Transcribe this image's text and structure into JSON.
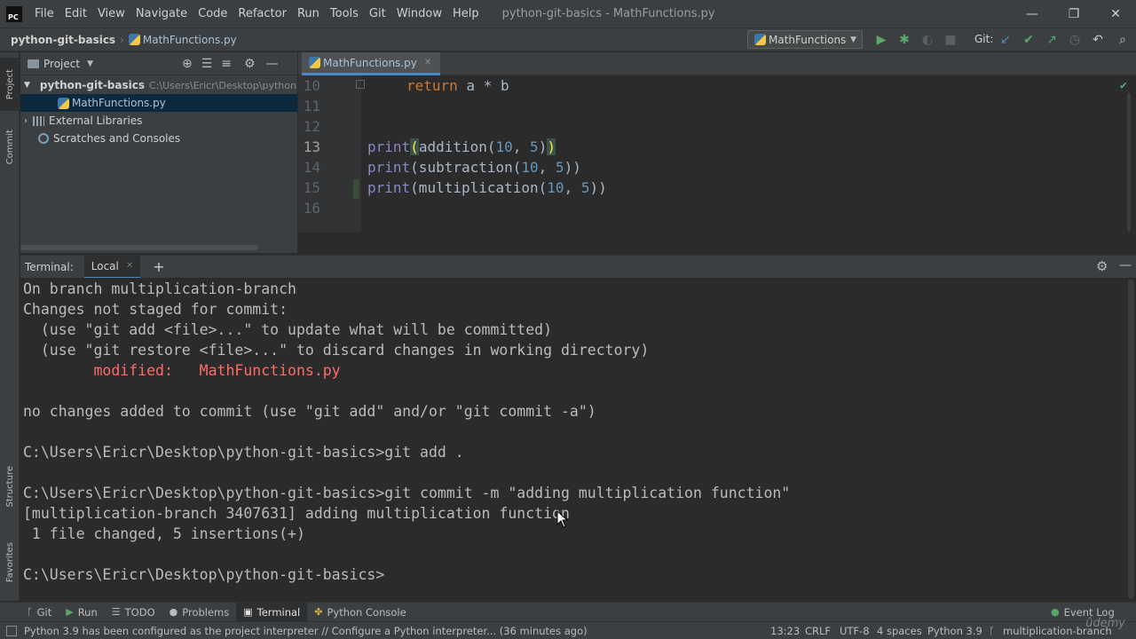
{
  "app": {
    "logo_text": "PC",
    "window_title": "python-git-basics - MathFunctions.py"
  },
  "menu": [
    "File",
    "Edit",
    "View",
    "Navigate",
    "Code",
    "Refactor",
    "Run",
    "Tools",
    "Git",
    "Window",
    "Help"
  ],
  "window_controls": {
    "minimize": "—",
    "restore": "❐",
    "close": "✕"
  },
  "navbar": {
    "project": "python-git-basics",
    "file": "MathFunctions.py",
    "run_config": "MathFunctions",
    "git_label": "Git:"
  },
  "left_strip": {
    "project": "Project",
    "commit": "Commit",
    "structure": "Structure",
    "favorites": "Favorites"
  },
  "project_panel": {
    "title": "Project",
    "tree": [
      {
        "label": "python-git-basics",
        "path": "C:\\Users\\Ericr\\Desktop\\python-g"
      },
      {
        "label": "MathFunctions.py"
      },
      {
        "label": "External Libraries"
      },
      {
        "label": "Scratches and Consoles"
      }
    ]
  },
  "editor": {
    "tab": "MathFunctions.py",
    "lines": [
      {
        "n": "10"
      },
      {
        "n": "11"
      },
      {
        "n": "12"
      },
      {
        "n": "13"
      },
      {
        "n": "14"
      },
      {
        "n": "15"
      },
      {
        "n": "16"
      }
    ],
    "code": {
      "l10_kw": "return",
      "l10_rest": " a * b",
      "l13_fn": "print",
      "l13_open": "(",
      "l13_call": "addition(",
      "l13_a": "10",
      "l13_sep": ", ",
      "l13_b": "5",
      "l13_close1": ")",
      "l13_close2": ")",
      "l14_fn": "print",
      "l14_call": "(subtraction(",
      "l14_a": "10",
      "l14_sep": ", ",
      "l14_b": "5",
      "l14_end": "))",
      "l15_fn": "print",
      "l15_call": "(multiplication(",
      "l15_a": "10",
      "l15_sep": ", ",
      "l15_b": "5",
      "l15_end": "))"
    }
  },
  "terminal": {
    "title": "Terminal:",
    "tab": "Local",
    "lines": [
      "On branch multiplication-branch",
      "Changes not staged for commit:",
      "  (use \"git add <file>...\" to update what will be committed)",
      "  (use \"git restore <file>...\" to discard changes in working directory)",
      "        modified:   MathFunctions.py",
      "",
      "no changes added to commit (use \"git add\" and/or \"git commit -a\")",
      "",
      "C:\\Users\\Ericr\\Desktop\\python-git-basics>git add .",
      "",
      "C:\\Users\\Ericr\\Desktop\\python-git-basics>git commit -m \"adding multiplication function\"",
      "[multiplication-branch 3407631] adding multiplication function",
      " 1 file changed, 5 insertions(+)",
      "",
      "C:\\Users\\Ericr\\Desktop\\python-git-basics>"
    ]
  },
  "bottom_tabs": [
    "Git",
    "Run",
    "TODO",
    "Problems",
    "Terminal",
    "Python Console"
  ],
  "event_log": "Event Log",
  "status": {
    "message": "Python 3.9 has been configured as the project interpreter // Configure a Python interpreter... (36 minutes ago)",
    "position": "13:23",
    "line_sep": "CRLF",
    "encoding": "UTF-8",
    "indent": "4 spaces",
    "interpreter": "Python 3.9",
    "branch": "multiplication-branch"
  },
  "watermark": "ûdemy",
  "colors": {
    "accent": "#4a88c7",
    "keyword": "#cc7832",
    "number": "#6897bb",
    "builtin": "#8888c6",
    "modified": "#ff6b68"
  }
}
